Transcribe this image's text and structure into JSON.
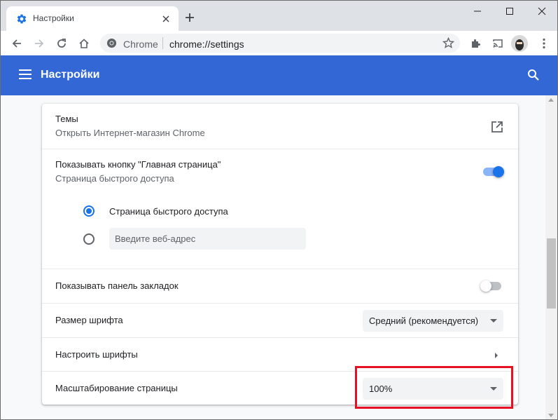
{
  "window": {
    "tab_title": "Настройки",
    "minimize_icon": "minimize-icon",
    "maximize_icon": "maximize-icon",
    "close_icon": "close-icon"
  },
  "toolbar": {
    "omnibox_scheme_label": "Chrome",
    "omnibox_url": "chrome://settings"
  },
  "header": {
    "title": "Настройки"
  },
  "appearance": {
    "themes_label": "Темы",
    "themes_sub": "Открыть Интернет-магазин Chrome",
    "home_button_label": "Показывать кнопку \"Главная страница\"",
    "home_button_sub": "Страница быстрого доступа",
    "home_button_enabled": true,
    "radio_newtab_label": "Страница быстрого доступа",
    "radio_custom_placeholder": "Введите веб-адрес",
    "selected_radio": "newtab",
    "bookmarks_bar_label": "Показывать панель закладок",
    "bookmarks_bar_enabled": false,
    "font_size_label": "Размер шрифта",
    "font_size_value": "Средний (рекомендуется)",
    "customize_fonts_label": "Настроить шрифты",
    "page_zoom_label": "Масштабирование страницы",
    "page_zoom_value": "100%"
  },
  "colors": {
    "header_blue": "#3367d6",
    "accent_blue": "#1a73e8",
    "highlight_red": "#e81123"
  }
}
